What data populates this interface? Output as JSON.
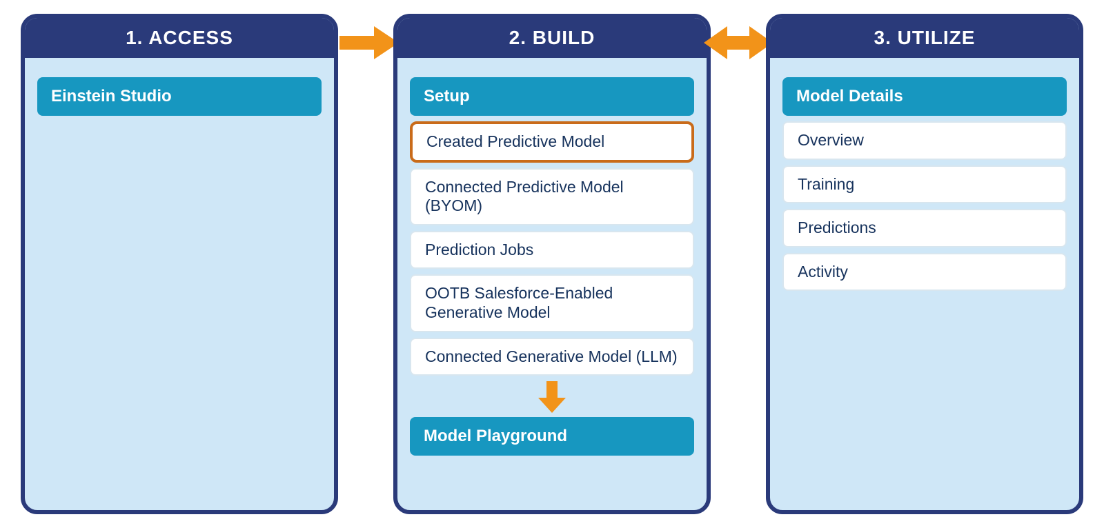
{
  "colors": {
    "panel_border": "#2a3a7a",
    "panel_fill": "#cfe7f7",
    "pill": "#1797c0",
    "arrow": "#f29319",
    "highlight_border": "#c96b1a",
    "text_dark": "#16325c"
  },
  "panels": {
    "access": {
      "title": "1. ACCESS",
      "pill": "Einstein Studio"
    },
    "build": {
      "title": "2. BUILD",
      "setup_pill": "Setup",
      "items": [
        "Created Predictive Model",
        "Connected Predictive Model (BYOM)",
        "Prediction Jobs",
        "OOTB Salesforce-Enabled Generative Model",
        "Connected Generative Model (LLM)"
      ],
      "playground_pill": "Model Playground"
    },
    "utilize": {
      "title": "3. UTILIZE",
      "details_pill": "Model Details",
      "items": [
        "Overview",
        "Training",
        "Predictions",
        "Activity"
      ]
    }
  },
  "arrows": {
    "access_to_build": "right",
    "build_utilize": "double",
    "setup_to_playground": "down"
  }
}
